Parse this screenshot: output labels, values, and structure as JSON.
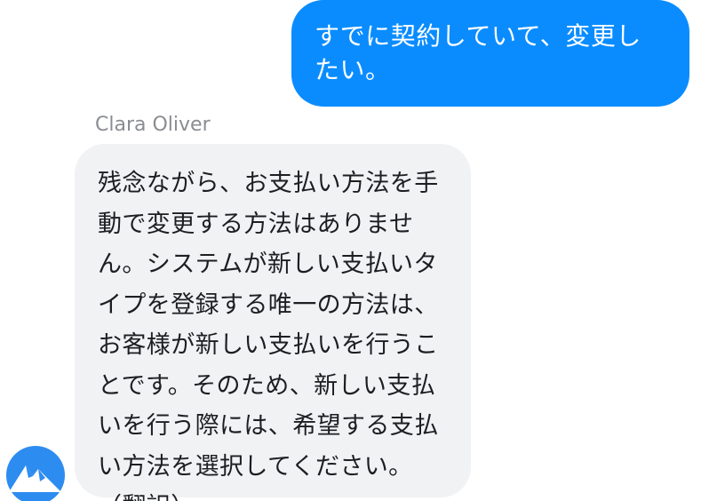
{
  "conversation": {
    "outgoing_message": "すでに契約していて、変更したい。",
    "sender_name": "Clara Oliver",
    "incoming_message": "残念ながら、お支払い方法を手動で変更する方法はありません。システムが新しい支払いタイプを登録する唯一の方法は、お客様が新しい支払いを行うことです。そのため、新しい支払いを行う際には、希望する支払い方法を選択してください。\n（翻訳）",
    "avatar_icon": "mountain-logo-icon"
  },
  "colors": {
    "outgoing_bubble": "#0a8cff",
    "incoming_bubble": "#f1f2f4",
    "avatar": "#2d8cf0"
  }
}
